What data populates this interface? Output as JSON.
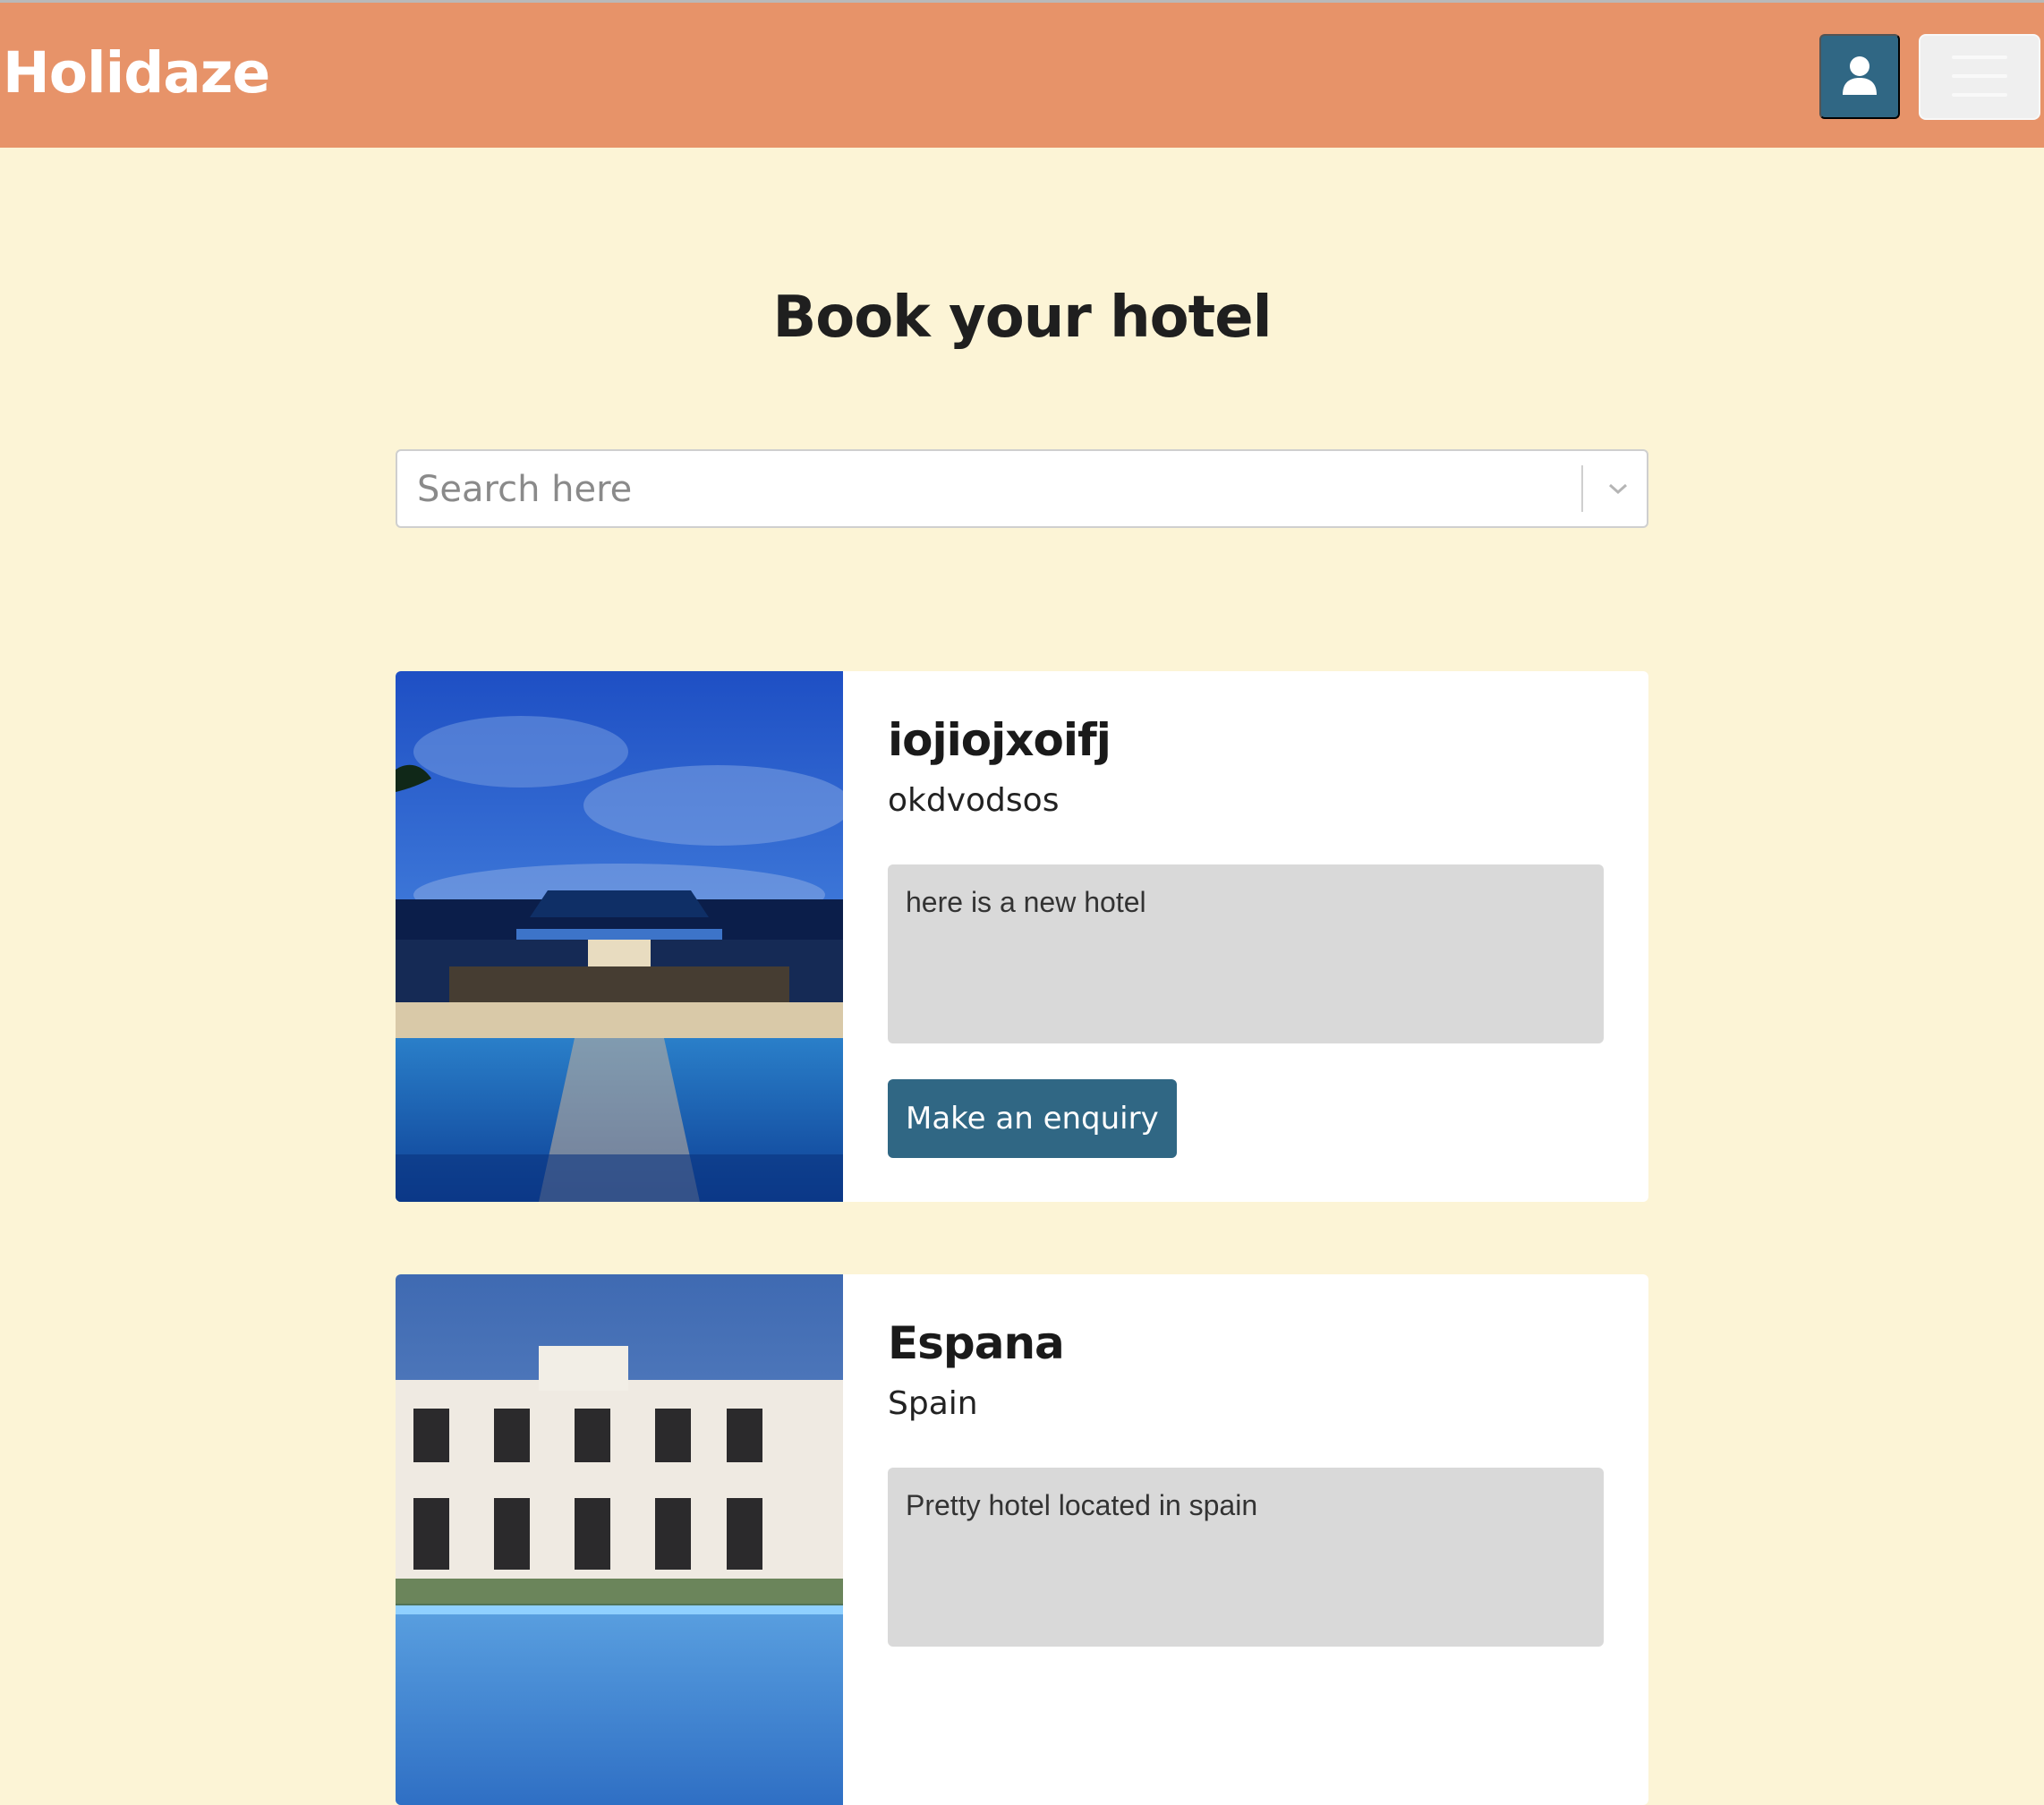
{
  "app": {
    "brand": "Holidaze"
  },
  "header": {
    "user_icon": "user-icon",
    "menu_icon": "hamburger-menu-icon"
  },
  "page": {
    "title": "Book your hotel"
  },
  "search": {
    "placeholder": "Search here",
    "icon": "chevron-down-icon"
  },
  "hotels": [
    {
      "name": "iojiojxoifj",
      "location": "okdvodsos",
      "description": "here is a new hotel",
      "button_label": "Make an enquiry"
    },
    {
      "name": "Espana",
      "location": "Spain",
      "description": "Pretty hotel located in spain",
      "button_label": ""
    }
  ],
  "colors": {
    "navbar": "#e79369",
    "background": "#fcf4d6",
    "primary": "#306784",
    "description_bg": "#d9d9d9"
  }
}
